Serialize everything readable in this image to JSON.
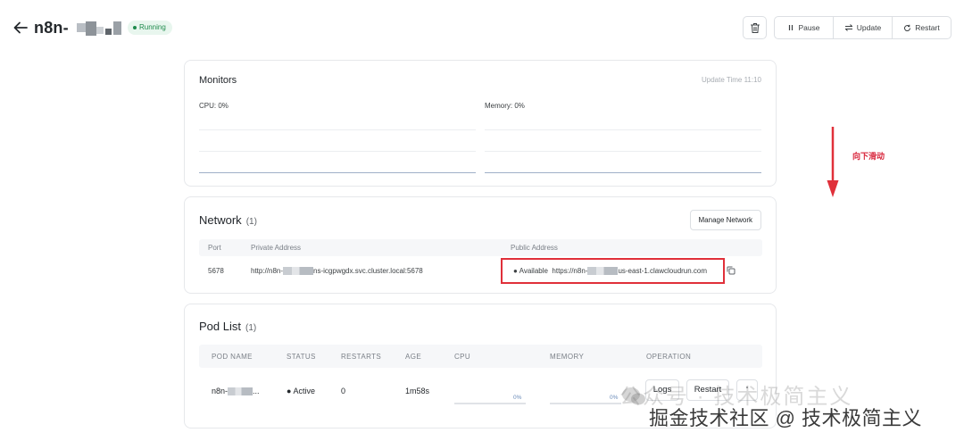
{
  "header": {
    "app_name": "n8n-",
    "status": "Running",
    "buttons": {
      "pause": "Pause",
      "update": "Update",
      "restart": "Restart"
    }
  },
  "monitors": {
    "title": "Monitors",
    "update_time": "Update Time  11:10",
    "cpu_label": "CPU:  0%",
    "memory_label": "Memory:  0%"
  },
  "network": {
    "title": "Network",
    "count": "(1)",
    "manage_button": "Manage Network",
    "columns": {
      "port": "Port",
      "private": "Private Address",
      "public": "Public Address"
    },
    "row": {
      "port": "5678",
      "private_prefix": "http://n8n-",
      "private_suffix": "ns-icgpwgdx.svc.cluster.local:5678",
      "status": "Available",
      "public_prefix": "https://n8n-",
      "public_suffix": "us-east-1.clawcloudrun.com"
    }
  },
  "pods": {
    "title": "Pod List",
    "count": "(1)",
    "columns": {
      "name": "POD NAME",
      "status": "STATUS",
      "restarts": "RESTARTS",
      "age": "AGE",
      "cpu": "CPU",
      "memory": "MEMORY",
      "operation": "OPERATION"
    },
    "row": {
      "name_prefix": "n8n-",
      "name_suffix": "...",
      "status": "Active",
      "restarts": "0",
      "age": "1m58s",
      "cpu_percent": 0,
      "cpu_label": "0%",
      "memory_percent": 0,
      "memory_label": "0%",
      "logs_button": "Logs",
      "restart_button": "Restart"
    }
  },
  "annotation": {
    "text": "向下滑动",
    "color": "#e0303a"
  },
  "watermark": {
    "line1": "公众号 · 技术极简主义",
    "line2": "掘金技术社区 @ 技术极简主义"
  },
  "colors": {
    "running": "#1e8a4c",
    "highlight": "#e0303a"
  }
}
